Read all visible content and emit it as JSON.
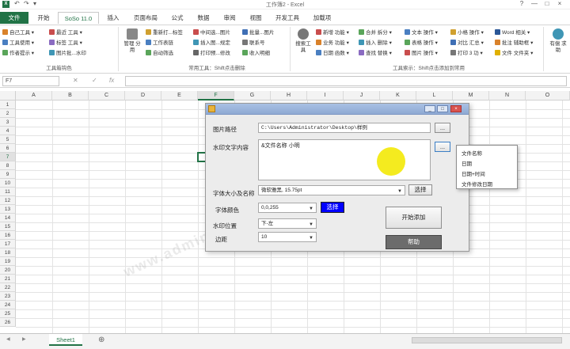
{
  "window": {
    "title": "工作簿2 - Excel",
    "quick_access": [
      "↶",
      "↷",
      "▾"
    ],
    "controls": [
      "?",
      "—",
      "□",
      "×"
    ]
  },
  "tabs": [
    {
      "label": "文件"
    },
    {
      "label": "开始"
    },
    {
      "label": "SoSo 11.0"
    },
    {
      "label": "插入"
    },
    {
      "label": "页面布局"
    },
    {
      "label": "公式"
    },
    {
      "label": "数据"
    },
    {
      "label": "审阅"
    },
    {
      "label": "视图"
    },
    {
      "label": "开发工具"
    },
    {
      "label": "加载项"
    }
  ],
  "ribbon": {
    "col1": [
      "自己工具 ▾",
      "工具使用 ▾",
      "作者提示 ▾"
    ],
    "col2": [
      "最近 工具 ▾",
      "标签 工具 ▾",
      "图片批...水印"
    ],
    "group1_label": "工具箱钩色",
    "big1": "管理\n分用",
    "col3": [
      "重新打...标签",
      "工作表链",
      "自动筛选"
    ],
    "col4": [
      "中间选...图片",
      "插入图...规定",
      "打印预...修改"
    ],
    "col5": [
      "批量...图片",
      "联系号",
      "收入明细"
    ],
    "group2_label": "常用工具：Shift点击删除",
    "big2": "搜索工\n具",
    "col6": [
      "新增 功能 ▾",
      "业务 功能 ▾",
      "日期 函数 ▾"
    ],
    "col7": [
      "合并 拆分 ▾",
      "插入 删除 ▾",
      "查找 替换 ▾"
    ],
    "col8": [
      "文本 操作 ▾",
      "表格 操作 ▾",
      "图片 操作 ▾"
    ],
    "col9": [
      "小格 操作 ▾",
      "对比 汇总 ▾",
      "打印 3 功 ▾"
    ],
    "col10": [
      "Word 相关 ▾",
      "批注 辅助框 ▾",
      "文件 文件夹 ▾"
    ],
    "group3_label": "工具索示：Shift点击添加到常用",
    "big3": "有偿\n求助"
  },
  "formula": {
    "namebox": "F7",
    "x": "✕",
    "check": "✓",
    "fx": "fx"
  },
  "grid": {
    "columns": [
      "A",
      "B",
      "C",
      "D",
      "E",
      "F",
      "G",
      "H",
      "I",
      "J",
      "K",
      "L",
      "M",
      "N",
      "O"
    ],
    "rows": [
      "1",
      "2",
      "3",
      "4",
      "5",
      "6",
      "7",
      "8",
      "9",
      "10",
      "11",
      "12",
      "13",
      "14",
      "15",
      "16",
      "17",
      "18",
      "19",
      "20",
      "21",
      "22",
      "23",
      "24",
      "25",
      "26"
    ],
    "selected_col": "F",
    "selected_row": "7"
  },
  "sheet": {
    "tab": "Sheet1",
    "add": "⊕",
    "nav_prev": "◀",
    "nav_next": "▶"
  },
  "dialog": {
    "controls": [
      "_",
      "□",
      "×"
    ],
    "path_label": "图片路径",
    "path_value": "C:\\Users\\Administrator\\Desktop\\样例",
    "browse": "...",
    "watermark_label": "水印文字内容",
    "watermark_value": "&文件名称 小明",
    "insert": "...",
    "font_label": "字体大小及名称",
    "font_value": "微软雅黑, 15.75pt",
    "font_btn": "选择",
    "color_label": "字体颜色",
    "color_value": "0,0,255",
    "color_btn": "选择",
    "color_swatch": "#0000ff",
    "position_label": "水印位置",
    "position_value": "下-左",
    "margin_label": "边距",
    "margin_value": "10",
    "start_btn": "开始添加",
    "help_btn": "帮助"
  },
  "popup": {
    "items": [
      "文件名称",
      "日期",
      "日期+时间",
      "文件修改日期"
    ]
  },
  "watermark_text": "www.admin5.net"
}
